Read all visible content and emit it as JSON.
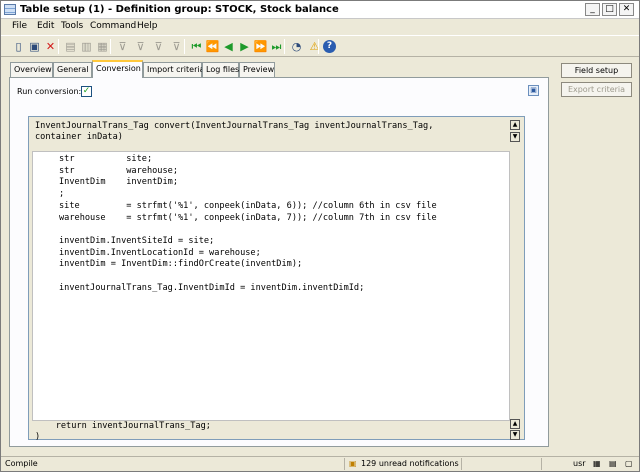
{
  "window": {
    "title": "Table setup (1) - Definition group: STOCK, Stock balance"
  },
  "titlebar": {
    "minimize": "_",
    "restore": "□",
    "close": "✕"
  },
  "menu": [
    "File",
    "Edit",
    "Tools",
    "Command",
    "Help"
  ],
  "toolbar": {
    "icons": [
      {
        "name": "new-icon",
        "glyph": "▯"
      },
      {
        "name": "save-icon",
        "glyph": "▣"
      },
      {
        "name": "delete-icon",
        "glyph": "✕"
      },
      {
        "name": "print-icon",
        "glyph": "▤"
      },
      {
        "name": "print-preview-icon",
        "glyph": "▥"
      },
      {
        "name": "export-icon",
        "glyph": "▦"
      },
      {
        "name": "filter-icon",
        "glyph": "⊽"
      },
      {
        "name": "filter-by-selection-icon",
        "glyph": "⊽"
      },
      {
        "name": "advanced-filter-icon",
        "glyph": "⊽"
      },
      {
        "name": "remove-filter-icon",
        "glyph": "⊽"
      },
      {
        "name": "first-record-icon",
        "glyph": "⏮"
      },
      {
        "name": "previous-page-icon",
        "glyph": "⏪"
      },
      {
        "name": "previous-record-icon",
        "glyph": "◀"
      },
      {
        "name": "next-record-icon",
        "glyph": "▶"
      },
      {
        "name": "next-page-icon",
        "glyph": "⏩"
      },
      {
        "name": "last-record-icon",
        "glyph": "⏭"
      },
      {
        "name": "go-to-main-table-icon",
        "glyph": "◔"
      },
      {
        "name": "alert-icon",
        "glyph": "⚠"
      },
      {
        "name": "help-icon",
        "glyph": "?"
      }
    ],
    "colors": {
      "nav": "#1d9a2a",
      "delete": "#d21a1a",
      "help": "#2a5db0",
      "alert": "#e0a000"
    }
  },
  "tabs": [
    "Overview",
    "General",
    "Conversion",
    "Import criteria",
    "Log files",
    "Preview"
  ],
  "active_tab": "Conversion",
  "conversion": {
    "run_label": "Run conversion:",
    "run_checked": "✓",
    "header": [
      "InventJournalTrans_Tag convert(InventJournalTrans_Tag inventJournalTrans_Tag,",
      "container inData)"
    ],
    "code": [
      "str          site;",
      "str          warehouse;",
      "InventDim    inventDim;",
      ";",
      "site         = strfmt('%1', conpeek(inData, 6)); //column 6th in csv file",
      "warehouse    = strfmt('%1', conpeek(inData, 7)); //column 7th in csv file",
      "",
      "inventDim.InventSiteId = site;",
      "inventDim.InventLocationId = warehouse;",
      "inventDim = InventDim::findOrCreate(inventDim);",
      "",
      "inventJournalTrans_Tag.InventDimId = inventDim.inventDimId;"
    ],
    "footer": [
      "    return inventJournalTrans_Tag;",
      ")"
    ]
  },
  "side_buttons": {
    "field_setup": "Field setup",
    "export_criteria": "Export criteria"
  },
  "status": {
    "left": "Compile",
    "notifications": "129 unread notifications",
    "user": "usr"
  }
}
